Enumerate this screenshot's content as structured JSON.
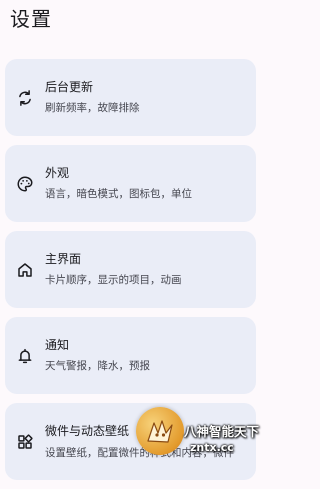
{
  "header": {
    "title": "设置"
  },
  "settings": [
    {
      "title": "后台更新",
      "subtitle": "刷新频率，故障排除",
      "icon": "sync-icon"
    },
    {
      "title": "外观",
      "subtitle": "语言，暗色模式，图标包，单位",
      "icon": "palette-icon"
    },
    {
      "title": "主界面",
      "subtitle": "卡片顺序，显示的项目，动画",
      "icon": "home-icon"
    },
    {
      "title": "通知",
      "subtitle": "天气警报，降水，预报",
      "icon": "bell-icon"
    },
    {
      "title": "微件与动态壁纸",
      "subtitle": "设置壁纸，配置微件的样式和内容，微件",
      "icon": "widgets-icon"
    }
  ],
  "watermark": {
    "line1": "八神智能天下",
    "line2": "zntx.cc",
    "icon": "mascot-logo"
  },
  "colors": {
    "background": "#fdf9fc",
    "card": "#eaedf7",
    "text_primary": "#1b1b1f",
    "text_secondary": "#45464f"
  }
}
